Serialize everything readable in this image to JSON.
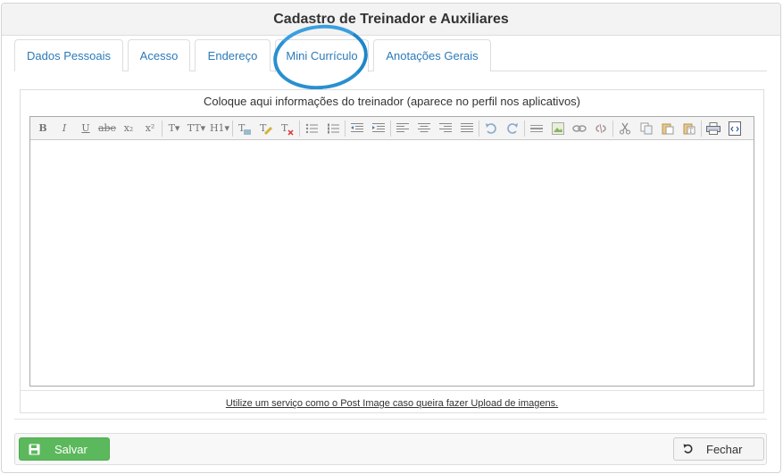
{
  "header": {
    "title": "Cadastro de Treinador e Auxiliares"
  },
  "tabs": [
    {
      "label": "Dados Pessoais"
    },
    {
      "label": "Acesso"
    },
    {
      "label": "Endereço"
    },
    {
      "label": "Mini Currículo",
      "active": true
    },
    {
      "label": "Anotações Gerais"
    }
  ],
  "editor": {
    "caption": "Coloque aqui informações do treinador (aparece no perfil nos aplicativos)",
    "toolbar": [
      "bold-icon",
      "italic-icon",
      "underline-icon",
      "strikethrough-icon",
      "subscript-icon",
      "superscript-icon",
      "font-icon",
      "font-size-icon",
      "heading-icon",
      "text-color-icon",
      "highlight-icon",
      "clear-format-icon",
      "bulleted-list-icon",
      "numbered-list-icon",
      "outdent-icon",
      "indent-icon",
      "align-left-icon",
      "align-center-icon",
      "align-right-icon",
      "justify-icon",
      "undo-icon",
      "redo-icon",
      "horizontal-rule-icon",
      "image-icon",
      "link-icon",
      "unlink-icon",
      "cut-icon",
      "copy-icon",
      "paste-icon",
      "paste-text-icon",
      "print-icon",
      "source-code-icon"
    ],
    "toolbar_text": {
      "bold": "B",
      "italic": "I",
      "underline": "U",
      "strike": "abe",
      "sub": "x₂",
      "sup": "x²",
      "font": "T",
      "size": "TT",
      "heading": "H1"
    },
    "upload_note": "Utilize um serviço como o Post Image caso queira fazer Upload de imagens."
  },
  "footer": {
    "save_label": "Salvar",
    "close_label": "Fechar"
  },
  "colors": {
    "accent": "#2a7ab9",
    "success": "#5cb85c",
    "annotation_circle": "#2a8fd0"
  }
}
